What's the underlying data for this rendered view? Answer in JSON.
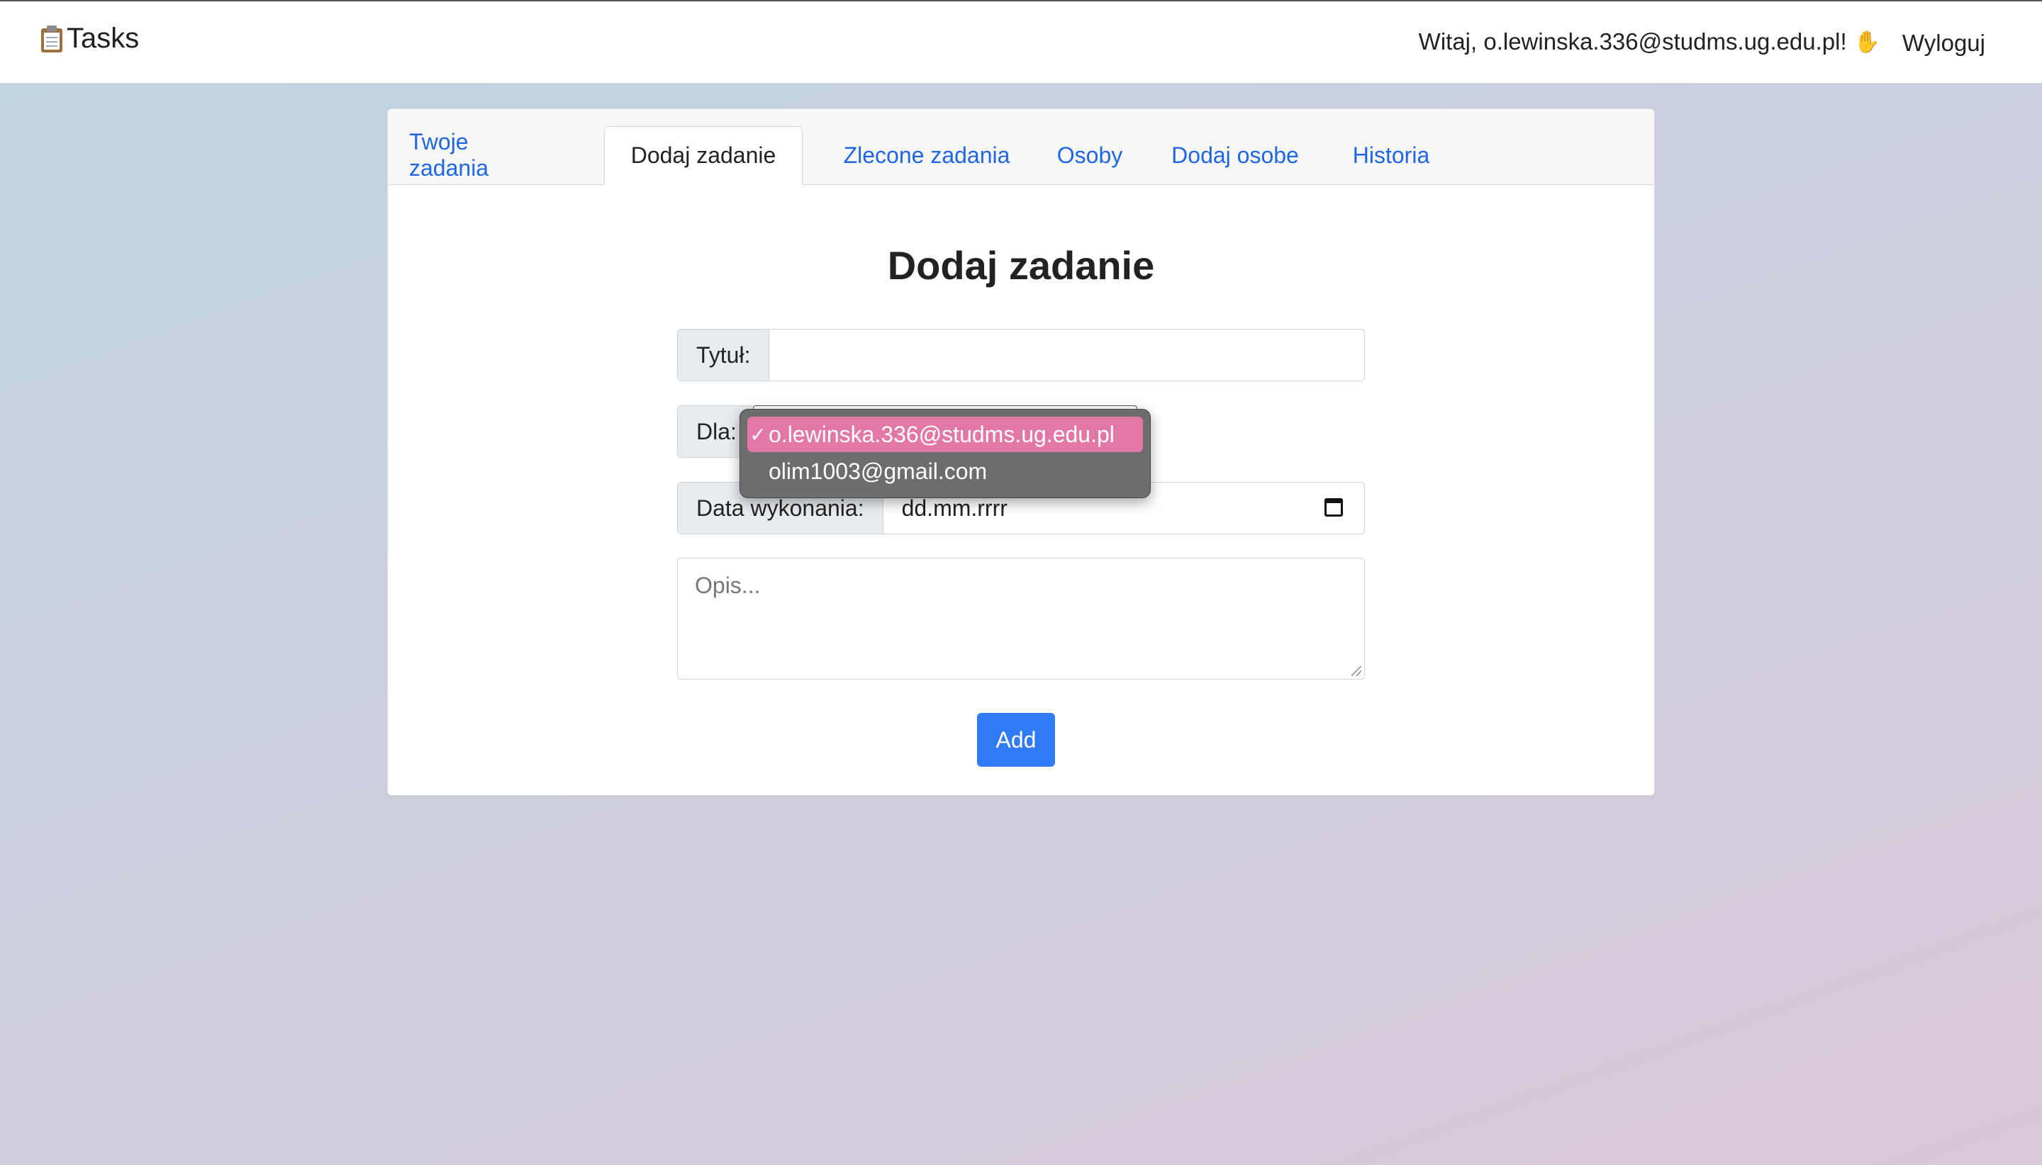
{
  "header": {
    "brand": "Tasks",
    "greeting": "Witaj, o.lewinska.336@studms.ug.edu.pl!",
    "logout": "Wyloguj"
  },
  "tabs": [
    {
      "label": "Twoje zadania",
      "active": false
    },
    {
      "label": "Dodaj zadanie",
      "active": true
    },
    {
      "label": "Zlecone zadania",
      "active": false
    },
    {
      "label": "Osoby",
      "active": false
    },
    {
      "label": "Dodaj osobe",
      "active": false
    },
    {
      "label": "Historia",
      "active": false
    }
  ],
  "form": {
    "title": "Dodaj zadanie",
    "title_label": "Tytuł:",
    "title_value": "",
    "for_label": "Dla:",
    "for_options": [
      "o.lewinska.336@studms.ug.edu.pl",
      "olim1003@gmail.com"
    ],
    "for_selected": "o.lewinska.336@studms.ug.edu.pl",
    "due_label": "Data wykonania:",
    "due_placeholder": "dd.mm.rrrr",
    "description_placeholder": "Opis...",
    "submit": "Add"
  },
  "colors": {
    "accent": "#2f7cf6",
    "link": "#1e66e6",
    "dropdown_selected": "#e278a6"
  }
}
